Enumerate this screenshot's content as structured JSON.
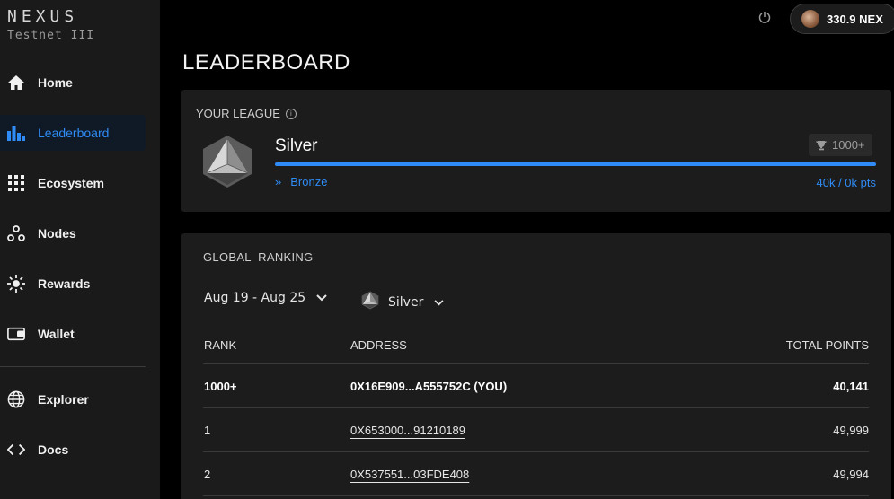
{
  "brand": {
    "name": "NEXUS",
    "subtitle": "Testnet III"
  },
  "nav": {
    "items": [
      {
        "label": "Home",
        "icon": "home-icon"
      },
      {
        "label": "Leaderboard",
        "icon": "bar-chart-icon",
        "active": true
      },
      {
        "label": "Ecosystem",
        "icon": "grid-icon"
      },
      {
        "label": "Nodes",
        "icon": "nodes-icon"
      },
      {
        "label": "Rewards",
        "icon": "sparkle-icon"
      },
      {
        "label": "Wallet",
        "icon": "wallet-icon"
      },
      {
        "label": "Explorer",
        "icon": "globe-icon"
      },
      {
        "label": "Docs",
        "icon": "code-icon"
      }
    ]
  },
  "topbar": {
    "balance": "330.9 NEX"
  },
  "page": {
    "title": "LEADERBOARD"
  },
  "league": {
    "heading": "YOUR LEAGUE",
    "name": "Silver",
    "trophy": "1000+",
    "progress": 1.0,
    "next_league": "Bronze",
    "points": "40k / 0k pts"
  },
  "ranking": {
    "heading": "GLOBAL  RANKING",
    "date_filter": "Aug 19 - Aug 25",
    "league_filter": "Silver",
    "columns": {
      "rank": "RANK",
      "address": "ADDRESS",
      "points": "TOTAL POINTS"
    },
    "rows": [
      {
        "rank": "1000+",
        "address": "0X16E909...A555752C (YOU)",
        "points": "40,141"
      },
      {
        "rank": "1",
        "address": "0X653000...91210189",
        "points": "49,999"
      },
      {
        "rank": "2",
        "address": "0X537551...03FDE408",
        "points": "49,994"
      }
    ]
  },
  "colors": {
    "accent": "#2f8bf5",
    "background": "#000000",
    "card": "#1c1c1c",
    "sidebar": "#1a1a1a"
  }
}
